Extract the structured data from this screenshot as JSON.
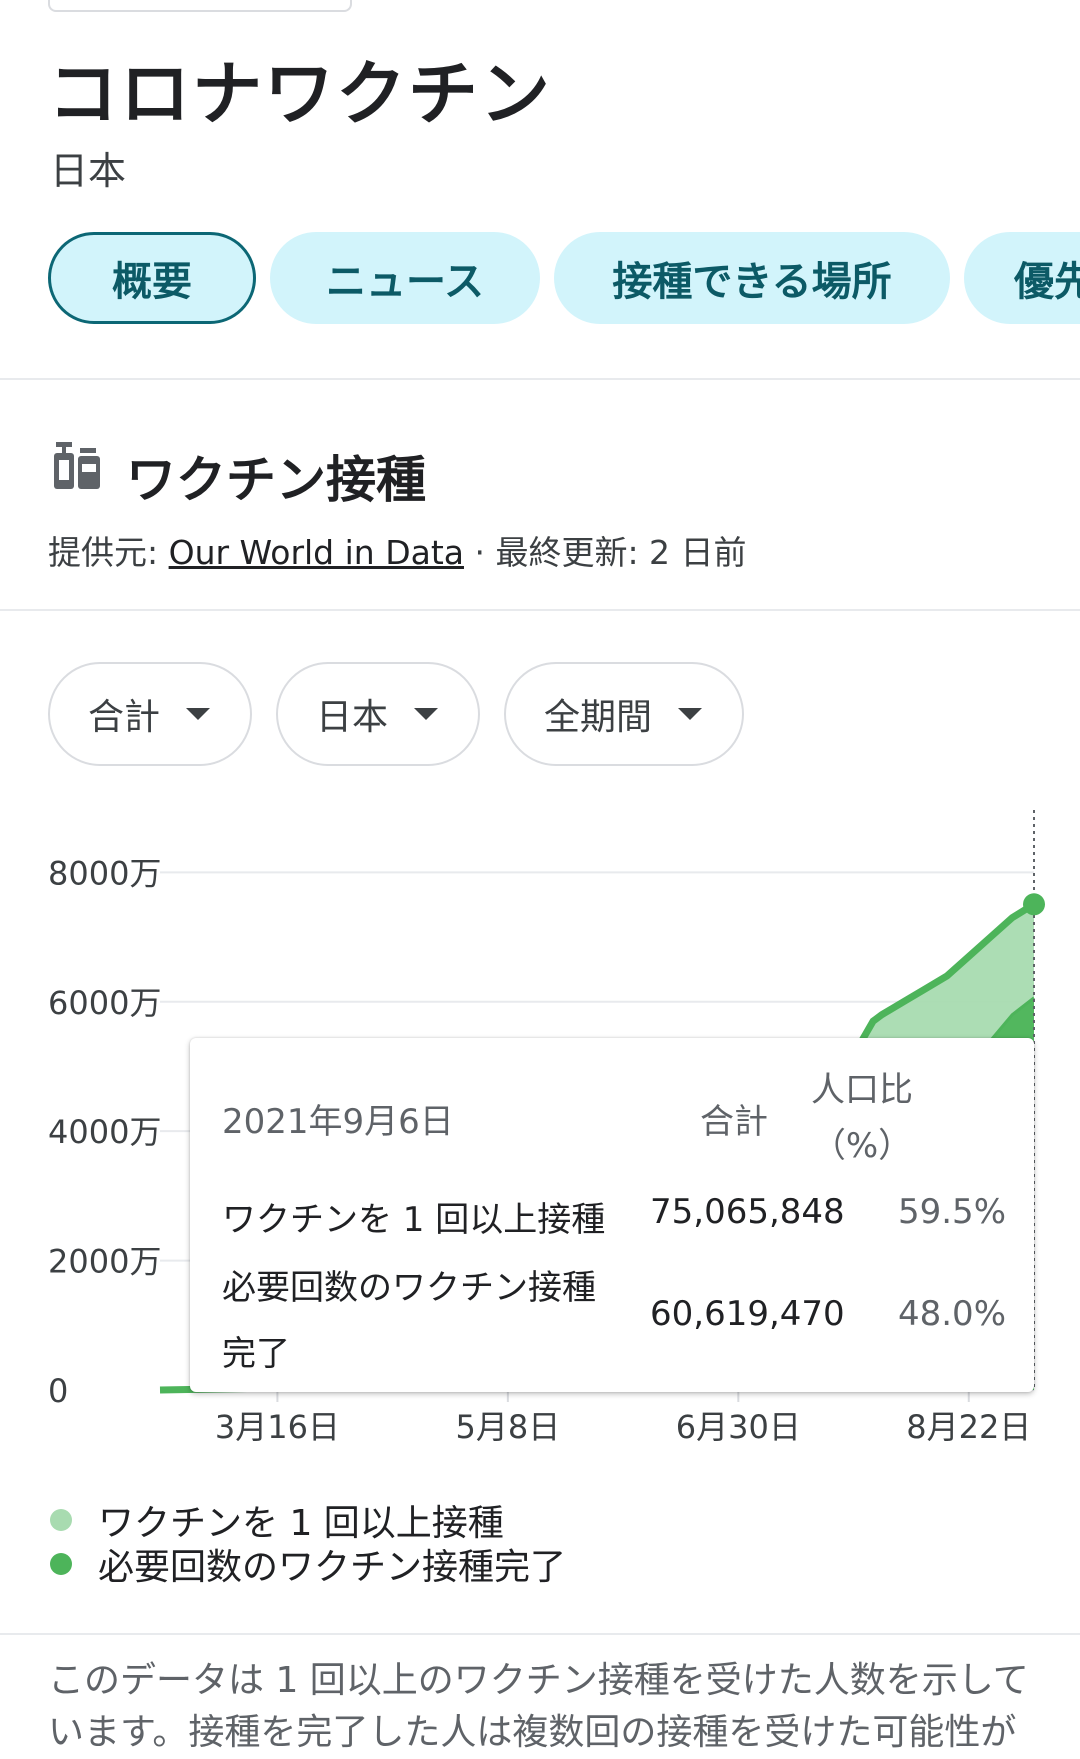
{
  "page": {
    "title": "コロナワクチン",
    "region": "日本"
  },
  "tabs": [
    {
      "label": "概要",
      "active": true
    },
    {
      "label": "ニュース",
      "active": false
    },
    {
      "label": "接種できる場所",
      "active": false
    },
    {
      "label": "優先",
      "active": false
    }
  ],
  "section": {
    "title": "ワクチン接種",
    "icon": "vaccine-vial-icon",
    "source_prefix": "提供元: ",
    "source_link": "Our World in Data",
    "updated": " · 最終更新: 2 日前"
  },
  "filters": [
    {
      "label": "合計"
    },
    {
      "label": "日本"
    },
    {
      "label": "全期間"
    }
  ],
  "tooltip": {
    "date": "2021年9月6日",
    "col_total": "合計",
    "col_pct_line1": "人口比",
    "col_pct_line2": "（%）",
    "rows": [
      {
        "label": "ワクチンを 1 回以上接種",
        "label2": "",
        "total": "75,065,848",
        "pct": "59.5%"
      },
      {
        "label": "必要回数のワクチン接種",
        "label2": "完了",
        "total": "60,619,470",
        "pct": "48.0%"
      }
    ]
  },
  "legend": [
    {
      "label": "ワクチンを 1 回以上接種",
      "color": "#a8dbb0"
    },
    {
      "label": "必要回数のワクチン接種完了",
      "color": "#4db45a"
    }
  ],
  "note": "このデータは 1 回以上のワクチン接種を受けた人数を示しています。接種を完了した人は複数回の接種を受けた可能性が",
  "chart_data": {
    "type": "area",
    "y_tick_labels": [
      "0",
      "2000万",
      "4000万",
      "6000万",
      "8000万"
    ],
    "y_ticks": [
      0,
      20000000,
      40000000,
      60000000,
      80000000
    ],
    "ylim": [
      0,
      85000000
    ],
    "x_tick_labels": [
      "3月16日",
      "5月8日",
      "6月30日",
      "8月22日"
    ],
    "x_ticks": [
      "2021-03-16",
      "2021-05-08",
      "2021-06-30",
      "2021-08-22"
    ],
    "xlim": [
      "2021-02-17",
      "2021-09-06"
    ],
    "grid": true,
    "series": [
      {
        "name": "ワクチンを 1 回以上接種",
        "color": "#a8dbb0",
        "x": [
          "2021-02-17",
          "2021-03-16",
          "2021-04-15",
          "2021-05-08",
          "2021-06-01",
          "2021-06-30",
          "2021-07-25",
          "2021-07-31",
          "2021-08-02",
          "2021-08-07",
          "2021-08-12",
          "2021-08-17",
          "2021-08-22",
          "2021-08-27",
          "2021-09-01",
          "2021-09-06"
        ],
        "y": [
          0,
          300000,
          1500000,
          4000000,
          12000000,
          30000000,
          50000000,
          57000000,
          58000000,
          60000000,
          62000000,
          64000000,
          67000000,
          70000000,
          73000000,
          75065848
        ]
      },
      {
        "name": "必要回数のワクチン接種完了",
        "color": "#4db45a",
        "x": [
          "2021-02-17",
          "2021-03-16",
          "2021-04-15",
          "2021-05-08",
          "2021-06-01",
          "2021-06-30",
          "2021-07-25",
          "2021-08-02",
          "2021-08-12",
          "2021-08-22",
          "2021-08-27",
          "2021-09-01",
          "2021-09-06"
        ],
        "y": [
          0,
          100000,
          800000,
          1500000,
          3000000,
          11000000,
          28000000,
          34000000,
          42000000,
          50000000,
          54000000,
          58000000,
          60619470
        ]
      }
    ],
    "highlight_date": "2021-09-06"
  }
}
